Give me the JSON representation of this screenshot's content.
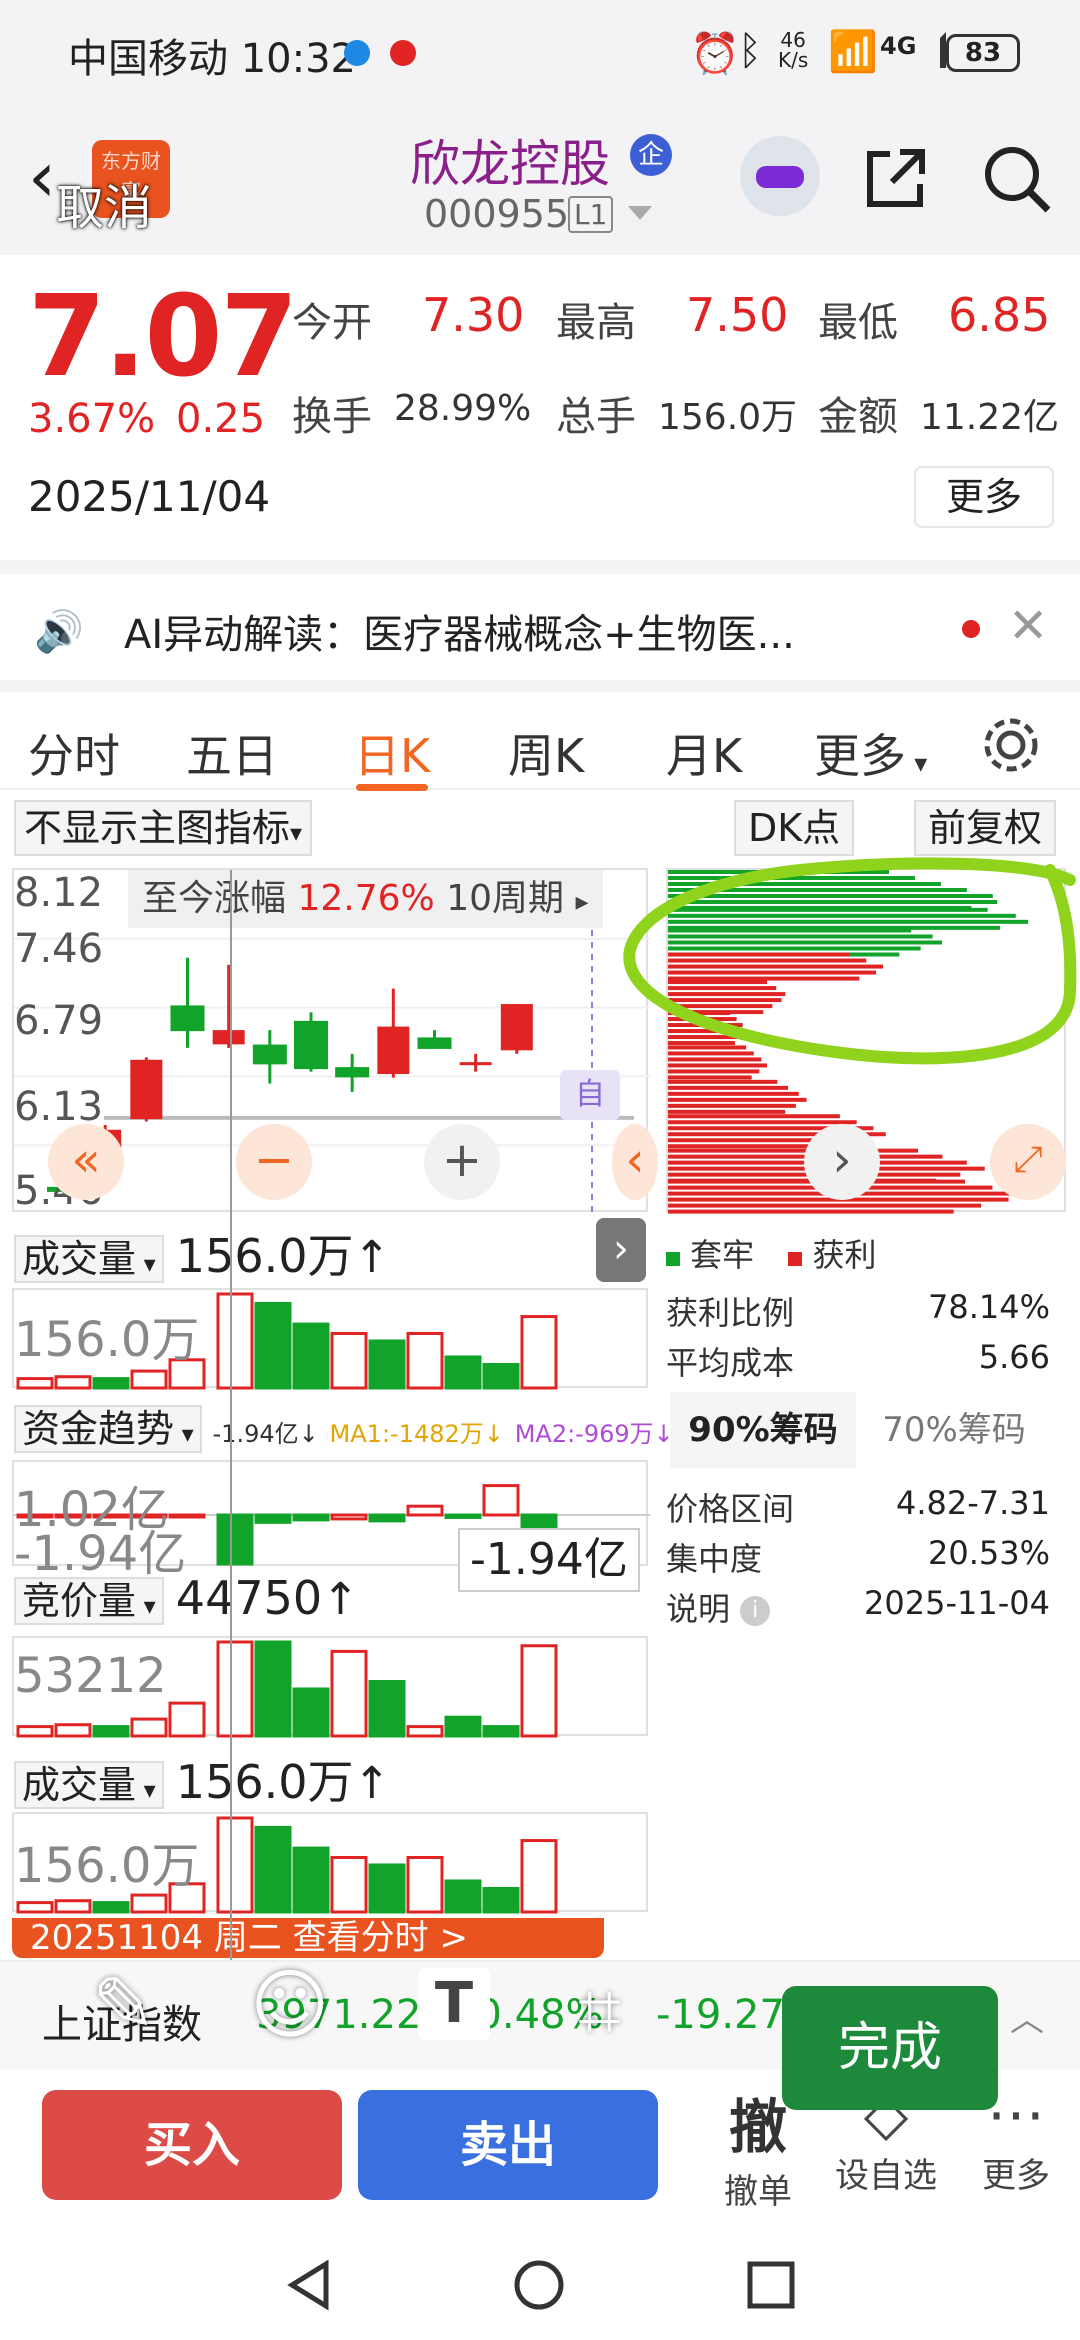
{
  "status_bar": {
    "carrier_time": "中国移动 10:32",
    "net_speed_top": "46",
    "net_speed_bottom": "K/s",
    "signal_label": "4G",
    "battery": "83"
  },
  "header": {
    "logo_text": "东方财富",
    "cancel_overlay": "取消",
    "stock_name": "欣龙控股",
    "badge": "企",
    "code": "000955",
    "level": "L1"
  },
  "quote": {
    "price": "7.07",
    "change_pct": "3.67%",
    "change_abs": "0.25",
    "date": "2025/11/04",
    "open_label": "今开",
    "open": "7.30",
    "high_label": "最高",
    "high": "7.50",
    "low_label": "最低",
    "low": "6.85",
    "turnover_label": "换手",
    "turnover": "28.99%",
    "volume_label": "总手",
    "volume": "156.0万",
    "amount_label": "金额",
    "amount": "11.22亿",
    "more": "更多"
  },
  "ai_banner": {
    "text": "AI异动解读：医疗器械概念+生物医..."
  },
  "tabs": [
    "分时",
    "五日",
    "日K",
    "周K",
    "月K",
    "更多"
  ],
  "active_tab": "日K",
  "controls": {
    "indicator": "不显示主图指标",
    "dk": "DK点",
    "adjust": "前复权",
    "tip_label": "至今涨幅",
    "tip_value": "12.76%",
    "tip_period": "10周期",
    "auto_tag": "自"
  },
  "price_axis": [
    "8.12",
    "7.46",
    "6.79",
    "6.13",
    "5.46"
  ],
  "sub_panels": {
    "vol1_label": "成交量",
    "vol1_value": "156.0万",
    "vol1_axis": "156.0万",
    "fund_label": "资金趋势",
    "fund_value": "-1.94亿↓",
    "fund_ma1": "MA1:-1482万↓",
    "fund_ma2": "MA2:-969万↓",
    "fund_axis_top": "1.02亿",
    "fund_axis_bottom": "-1.94亿",
    "fund_big": "-1.94亿",
    "auction_label": "竞价量",
    "auction_value": "44750",
    "auction_axis": "53212",
    "vol2_label": "成交量",
    "vol2_value": "156.0万",
    "vol2_axis": "156.0万",
    "date_strip": "20251104 周二 查看分时 >"
  },
  "chip": {
    "legend_trapped": "套牢",
    "legend_profit": "获利",
    "profit_ratio_label": "获利比例",
    "profit_ratio": "78.14%",
    "avg_cost_label": "平均成本",
    "avg_cost": "5.66",
    "tab90": "90%筹码",
    "tab70": "70%筹码",
    "range_label": "价格区间",
    "range": "4.82-7.31",
    "concentration_label": "集中度",
    "concentration": "20.53%",
    "note_label": "说明",
    "note_date": "2025-11-04"
  },
  "ticker": {
    "name": "上证指数",
    "value": "3971.22",
    "pct": "-0.48%",
    "chg": "-19.27"
  },
  "bottom": {
    "buy": "买入",
    "sell": "卖出",
    "cancel_order_icon": "撤",
    "cancel_order": "撤单",
    "watchlist": "设自选",
    "more": "更多",
    "done": "完成",
    "text_tool": "T"
  },
  "colors": {
    "up": "#e02424",
    "down": "#11a32a",
    "accent": "#f26522",
    "annotation": "#8fd31c"
  },
  "chart_data": {
    "type": "candlestick",
    "y_axis_ticks": [
      "8.12",
      "7.46",
      "6.79",
      "6.13",
      "5.46"
    ],
    "ylim": [
      5.3,
      8.2
    ],
    "candles": [
      {
        "o": 5.52,
        "c": 5.52,
        "h": 5.55,
        "l": 5.45,
        "up": false
      },
      {
        "o": 5.62,
        "c": 6.01,
        "h": 6.05,
        "l": 5.6,
        "up": true
      },
      {
        "o": 6.1,
        "c": 6.6,
        "h": 6.62,
        "l": 6.08,
        "up": true
      },
      {
        "o": 6.85,
        "c": 7.05,
        "h": 7.46,
        "l": 6.7,
        "up": false
      },
      {
        "o": 6.85,
        "c": 6.73,
        "h": 7.4,
        "l": 6.7,
        "up": true
      },
      {
        "o": 6.57,
        "c": 6.72,
        "h": 6.85,
        "l": 6.4,
        "up": false
      },
      {
        "o": 6.53,
        "c": 6.92,
        "h": 7.0,
        "l": 6.5,
        "up": false
      },
      {
        "o": 6.46,
        "c": 6.53,
        "h": 6.65,
        "l": 6.33,
        "up": false
      },
      {
        "o": 6.88,
        "c": 6.48,
        "h": 7.2,
        "l": 6.45,
        "up": true
      },
      {
        "o": 6.7,
        "c": 6.78,
        "h": 6.85,
        "l": 6.7,
        "up": false
      },
      {
        "o": 6.58,
        "c": 6.58,
        "h": 6.65,
        "l": 6.5,
        "up": true
      },
      {
        "o": 6.68,
        "c": 7.07,
        "h": 7.07,
        "l": 6.65,
        "up": true
      }
    ],
    "volume": [
      {
        "v": 0.1,
        "up": true
      },
      {
        "v": 0.12,
        "up": true
      },
      {
        "v": 0.1,
        "up": false
      },
      {
        "v": 0.18,
        "up": true
      },
      {
        "v": 0.3,
        "up": true
      },
      {
        "v": 1.0,
        "up": true
      },
      {
        "v": 0.9,
        "up": false
      },
      {
        "v": 0.68,
        "up": false
      },
      {
        "v": 0.58,
        "up": true
      },
      {
        "v": 0.5,
        "up": false
      },
      {
        "v": 0.58,
        "up": true
      },
      {
        "v": 0.33,
        "up": false
      },
      {
        "v": 0.25,
        "up": false
      },
      {
        "v": 0.76,
        "up": true
      }
    ],
    "fund": [
      {
        "v": 0,
        "up": true
      },
      {
        "v": 0,
        "up": true
      },
      {
        "v": 0,
        "up": true
      },
      {
        "v": 0,
        "up": true
      },
      {
        "v": 0,
        "up": true
      },
      {
        "v": -1.0,
        "up": false
      },
      {
        "v": -0.15,
        "up": false
      },
      {
        "v": -0.1,
        "up": false
      },
      {
        "v": -0.08,
        "up": true
      },
      {
        "v": -0.12,
        "up": false
      },
      {
        "v": 0.18,
        "up": true
      },
      {
        "v": -0.05,
        "up": false
      },
      {
        "v": 0.6,
        "up": true
      },
      {
        "v": -0.35,
        "up": false
      }
    ],
    "auction": [
      {
        "v": 0.1,
        "up": true
      },
      {
        "v": 0.12,
        "up": true
      },
      {
        "v": 0.1,
        "up": false
      },
      {
        "v": 0.18,
        "up": true
      },
      {
        "v": 0.35,
        "up": true
      },
      {
        "v": 1.0,
        "up": true
      },
      {
        "v": 1.0,
        "up": false
      },
      {
        "v": 0.5,
        "up": false
      },
      {
        "v": 0.9,
        "up": true
      },
      {
        "v": 0.58,
        "up": false
      },
      {
        "v": 0.1,
        "up": true
      },
      {
        "v": 0.2,
        "up": false
      },
      {
        "v": 0.1,
        "up": false
      },
      {
        "v": 0.96,
        "up": true
      }
    ],
    "chips": [
      {
        "y": 0.08,
        "w": 0.85,
        "green": true
      },
      {
        "y": 0.14,
        "w": 0.92,
        "green": true
      },
      {
        "y": 0.2,
        "w": 0.7,
        "green": true
      },
      {
        "y": 0.28,
        "w": 0.55,
        "green": false
      },
      {
        "y": 0.36,
        "w": 0.3,
        "green": false
      },
      {
        "y": 0.46,
        "w": 0.2,
        "green": false
      },
      {
        "y": 0.56,
        "w": 0.25,
        "green": false
      },
      {
        "y": 0.66,
        "w": 0.35,
        "green": false
      },
      {
        "y": 0.76,
        "w": 0.55,
        "green": false
      },
      {
        "y": 0.86,
        "w": 0.8,
        "green": false
      },
      {
        "y": 0.94,
        "w": 0.9,
        "green": false
      }
    ]
  }
}
